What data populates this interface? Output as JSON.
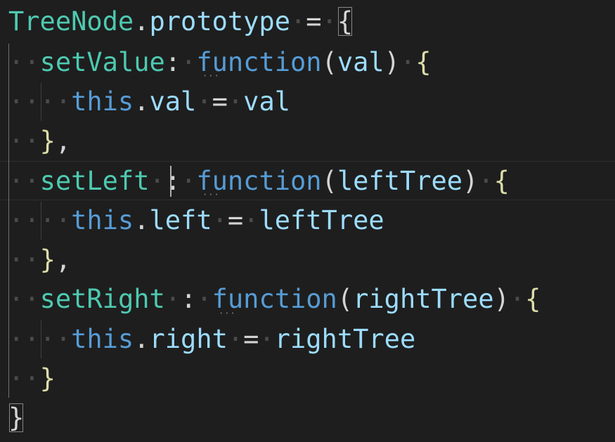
{
  "editor": {
    "lines": [
      {
        "tokens": [
          {
            "t": "TreeNode",
            "c": "ty"
          },
          {
            "t": ".",
            "c": "pl"
          },
          {
            "t": "prototype",
            "c": "vr"
          },
          {
            "t": "·",
            "c": "ws"
          },
          {
            "t": "=",
            "c": "pl"
          },
          {
            "t": "·",
            "c": "ws"
          },
          {
            "t": "{",
            "c": "br bracket-match"
          }
        ]
      },
      {
        "tokens": [
          {
            "t": "··",
            "c": "ws"
          },
          {
            "t": "setValue",
            "c": "ty"
          },
          {
            "t": ":",
            "c": "pl"
          },
          {
            "t": "·",
            "c": "ws"
          },
          {
            "t": "function",
            "c": "kw"
          },
          {
            "t": "(",
            "c": "pl"
          },
          {
            "t": "val",
            "c": "vr"
          },
          {
            "t": ")",
            "c": "pl"
          },
          {
            "t": "·",
            "c": "ws"
          },
          {
            "t": "{",
            "c": "fn"
          }
        ]
      },
      {
        "tokens": [
          {
            "t": "····",
            "c": "ws"
          },
          {
            "t": "this",
            "c": "kw"
          },
          {
            "t": ".",
            "c": "pl"
          },
          {
            "t": "val",
            "c": "vr"
          },
          {
            "t": "·",
            "c": "ws"
          },
          {
            "t": "=",
            "c": "pl"
          },
          {
            "t": "·",
            "c": "ws"
          },
          {
            "t": "val",
            "c": "vr"
          }
        ]
      },
      {
        "tokens": [
          {
            "t": "··",
            "c": "ws"
          },
          {
            "t": "}",
            "c": "fn"
          },
          {
            "t": ",",
            "c": "pl"
          }
        ]
      },
      {
        "tokens": [
          {
            "t": "··",
            "c": "ws"
          },
          {
            "t": "setLeft",
            "c": "ty"
          },
          {
            "t": "·",
            "c": "ws"
          },
          {
            "t": ":",
            "c": "pl"
          },
          {
            "t": "·",
            "c": "ws"
          },
          {
            "t": "function",
            "c": "kw"
          },
          {
            "t": "(",
            "c": "pl"
          },
          {
            "t": "leftTree",
            "c": "vr"
          },
          {
            "t": ")",
            "c": "pl"
          },
          {
            "t": "·",
            "c": "ws"
          },
          {
            "t": "{",
            "c": "fn"
          }
        ]
      },
      {
        "tokens": [
          {
            "t": "····",
            "c": "ws"
          },
          {
            "t": "this",
            "c": "kw"
          },
          {
            "t": ".",
            "c": "pl"
          },
          {
            "t": "left",
            "c": "vr"
          },
          {
            "t": "·",
            "c": "ws"
          },
          {
            "t": "=",
            "c": "pl"
          },
          {
            "t": "·",
            "c": "ws"
          },
          {
            "t": "leftTree",
            "c": "vr"
          }
        ]
      },
      {
        "tokens": [
          {
            "t": "··",
            "c": "ws"
          },
          {
            "t": "}",
            "c": "fn"
          },
          {
            "t": ",",
            "c": "pl"
          }
        ]
      },
      {
        "tokens": [
          {
            "t": "··",
            "c": "ws"
          },
          {
            "t": "setRight",
            "c": "ty"
          },
          {
            "t": "·",
            "c": "ws"
          },
          {
            "t": ":",
            "c": "pl"
          },
          {
            "t": "·",
            "c": "ws"
          },
          {
            "t": "function",
            "c": "kw"
          },
          {
            "t": "(",
            "c": "pl"
          },
          {
            "t": "rightTree",
            "c": "vr"
          },
          {
            "t": ")",
            "c": "pl"
          },
          {
            "t": "·",
            "c": "ws"
          },
          {
            "t": "{",
            "c": "fn"
          }
        ]
      },
      {
        "tokens": [
          {
            "t": "····",
            "c": "ws"
          },
          {
            "t": "this",
            "c": "kw"
          },
          {
            "t": ".",
            "c": "pl"
          },
          {
            "t": "right",
            "c": "vr"
          },
          {
            "t": "·",
            "c": "ws"
          },
          {
            "t": "=",
            "c": "pl"
          },
          {
            "t": "·",
            "c": "ws"
          },
          {
            "t": "rightTree",
            "c": "vr"
          }
        ]
      },
      {
        "tokens": [
          {
            "t": "··",
            "c": "ws"
          },
          {
            "t": "}",
            "c": "fn"
          }
        ]
      },
      {
        "tokens": [
          {
            "t": "}",
            "c": "br bracket-match"
          }
        ]
      }
    ]
  }
}
